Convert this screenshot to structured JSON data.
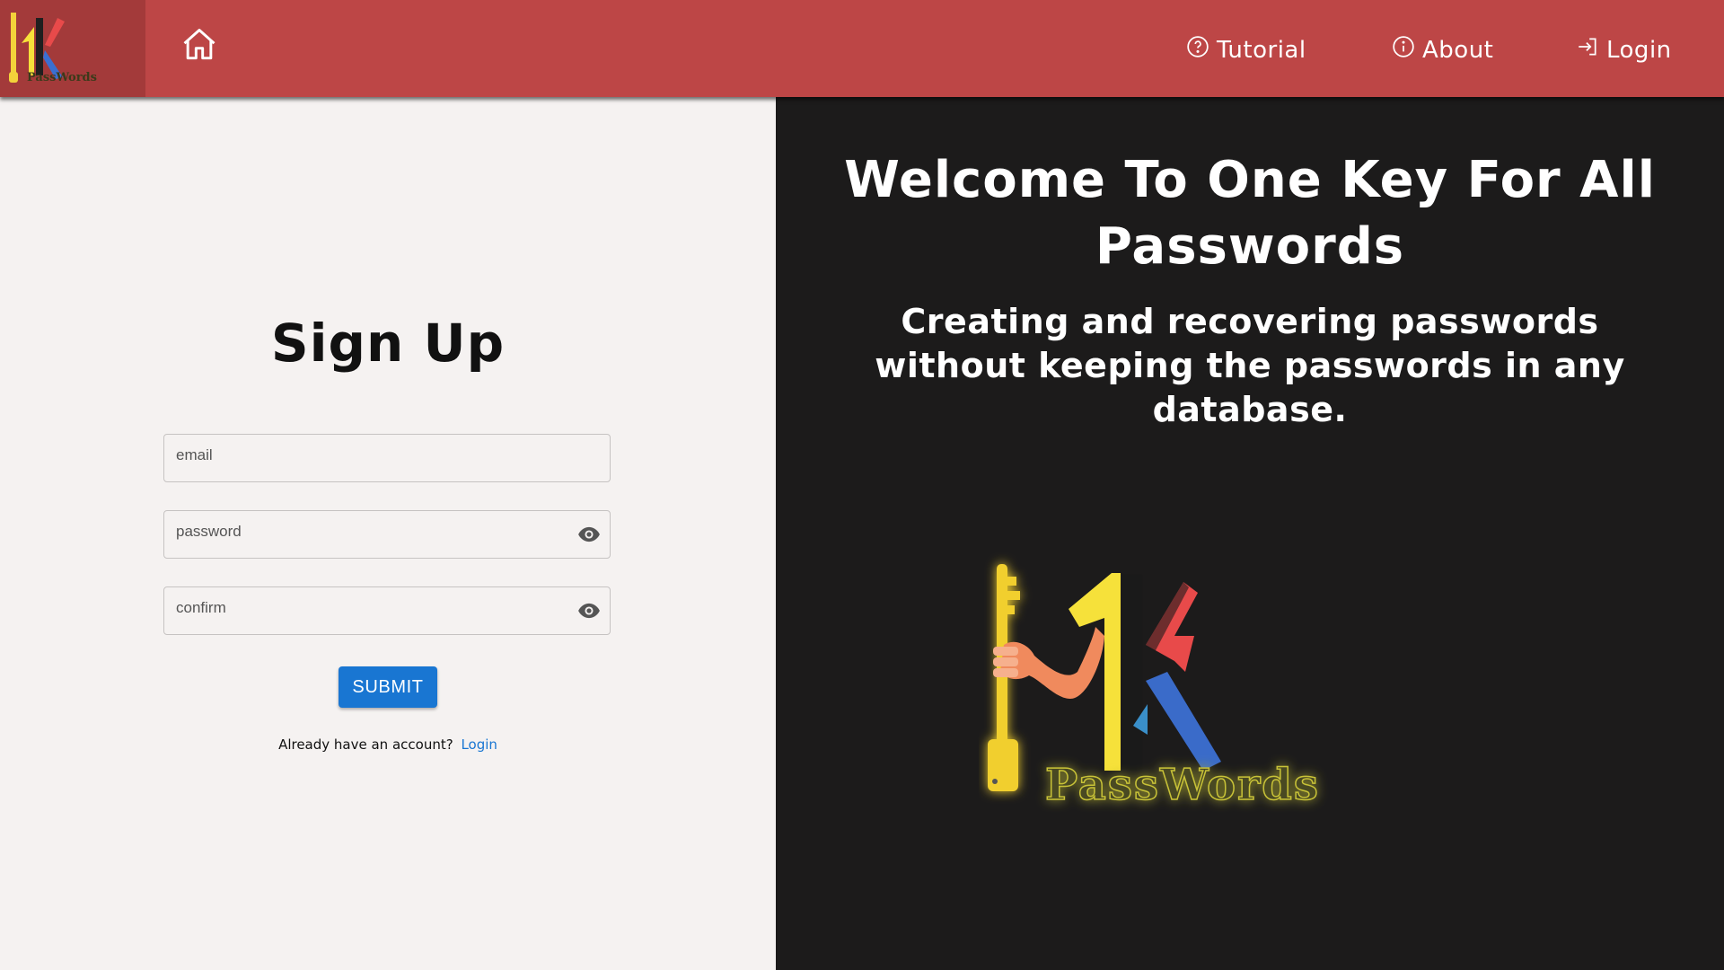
{
  "nav": {
    "logo_text": "PassWords",
    "links": [
      {
        "label": "Tutorial",
        "icon": "help-circle-icon"
      },
      {
        "label": "About",
        "icon": "info-circle-icon"
      },
      {
        "label": "Login",
        "icon": "login-arrow-icon"
      }
    ]
  },
  "signup": {
    "title": "Sign Up",
    "email_placeholder": "email",
    "password_placeholder": "password",
    "confirm_placeholder": "confirm",
    "submit_label": "SUBMIT",
    "already_text": "Already have an account?",
    "login_link": "Login"
  },
  "hero": {
    "title": "Welcome To One Key For All Passwords",
    "subtitle": "Creating and recovering passwords without keeping the passwords in any database.",
    "logo_text": "PassWords"
  },
  "colors": {
    "topbar": "#bd4646",
    "accent": "#1976d2",
    "dark_panel": "#1c1b1b",
    "light_panel": "#f5f2f1"
  }
}
